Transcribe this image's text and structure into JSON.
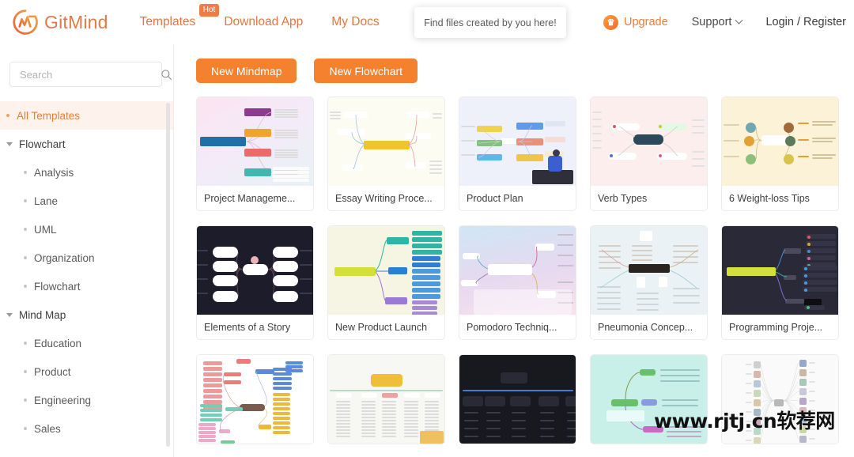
{
  "header": {
    "brand": "GitMind",
    "logo_icon": "gitmind-logo-icon",
    "nav": [
      {
        "label": "Templates",
        "badge": "Hot"
      },
      {
        "label": "Download App",
        "badge": ""
      },
      {
        "label": "My Docs",
        "badge": ""
      }
    ],
    "tooltip": "Find files created by you here!",
    "upgrade": {
      "label": "Upgrade",
      "icon": "crown-icon"
    },
    "support": {
      "label": "Support",
      "icon": "chevron-down-icon"
    },
    "login": "Login / Register",
    "accent_color": "#f07c30"
  },
  "sidebar": {
    "search": {
      "placeholder": "Search",
      "value": "",
      "icon": "search-icon"
    },
    "items": [
      {
        "label": "All Templates",
        "type": "item",
        "active": true
      },
      {
        "label": "Flowchart",
        "type": "group",
        "active": false
      },
      {
        "label": "Analysis",
        "type": "child",
        "active": false
      },
      {
        "label": "Lane",
        "type": "child",
        "active": false
      },
      {
        "label": "UML",
        "type": "child",
        "active": false
      },
      {
        "label": "Organization",
        "type": "child",
        "active": false
      },
      {
        "label": "Flowchart",
        "type": "child",
        "active": false
      },
      {
        "label": "Mind Map",
        "type": "group",
        "active": false
      },
      {
        "label": "Education",
        "type": "child",
        "active": false
      },
      {
        "label": "Product",
        "type": "child",
        "active": false
      },
      {
        "label": "Engineering",
        "type": "child",
        "active": false
      },
      {
        "label": "Sales",
        "type": "child",
        "active": false
      }
    ]
  },
  "main": {
    "buttons": [
      {
        "label": "New Mindmap"
      },
      {
        "label": "New Flowchart"
      }
    ],
    "templates": [
      {
        "title": "Project Manageme...",
        "thumb": "project-management",
        "bg": "#fbeaf3"
      },
      {
        "title": "Essay Writing Proce...",
        "thumb": "essay-writing",
        "bg": "#fdfbf0"
      },
      {
        "title": "Product Plan",
        "thumb": "product-plan",
        "bg": "#eef2fa"
      },
      {
        "title": "Verb Types",
        "thumb": "verb-types",
        "bg": "#fdeeee"
      },
      {
        "title": "6 Weight-loss Tips",
        "thumb": "weight-loss",
        "bg": "#fcf3d9"
      },
      {
        "title": "Elements of a Story",
        "thumb": "elements-story",
        "bg": "#1d1c2b"
      },
      {
        "title": "New Product Launch",
        "thumb": "new-product-launch",
        "bg": "#f6f4e3"
      },
      {
        "title": "Pomodoro Techniq...",
        "thumb": "pomodoro",
        "bg": "#d9ecf7"
      },
      {
        "title": "Pneumonia Concep...",
        "thumb": "pneumonia",
        "bg": "#e8f2f5"
      },
      {
        "title": "Programming Proje...",
        "thumb": "programming",
        "bg": "#252433"
      },
      {
        "title": "",
        "thumb": "row3-red-map",
        "bg": "#ffffff"
      },
      {
        "title": "",
        "thumb": "row3-yellow-map",
        "bg": "#f7f7f5"
      },
      {
        "title": "",
        "thumb": "row3-dark-sitemap",
        "bg": "#1a1a22"
      },
      {
        "title": "",
        "thumb": "row3-teal-map",
        "bg": "#c8efe9"
      },
      {
        "title": "",
        "thumb": "row3-icons-map",
        "bg": "#fafafa"
      }
    ]
  },
  "watermark": "www.rjtj.cn软荐网"
}
